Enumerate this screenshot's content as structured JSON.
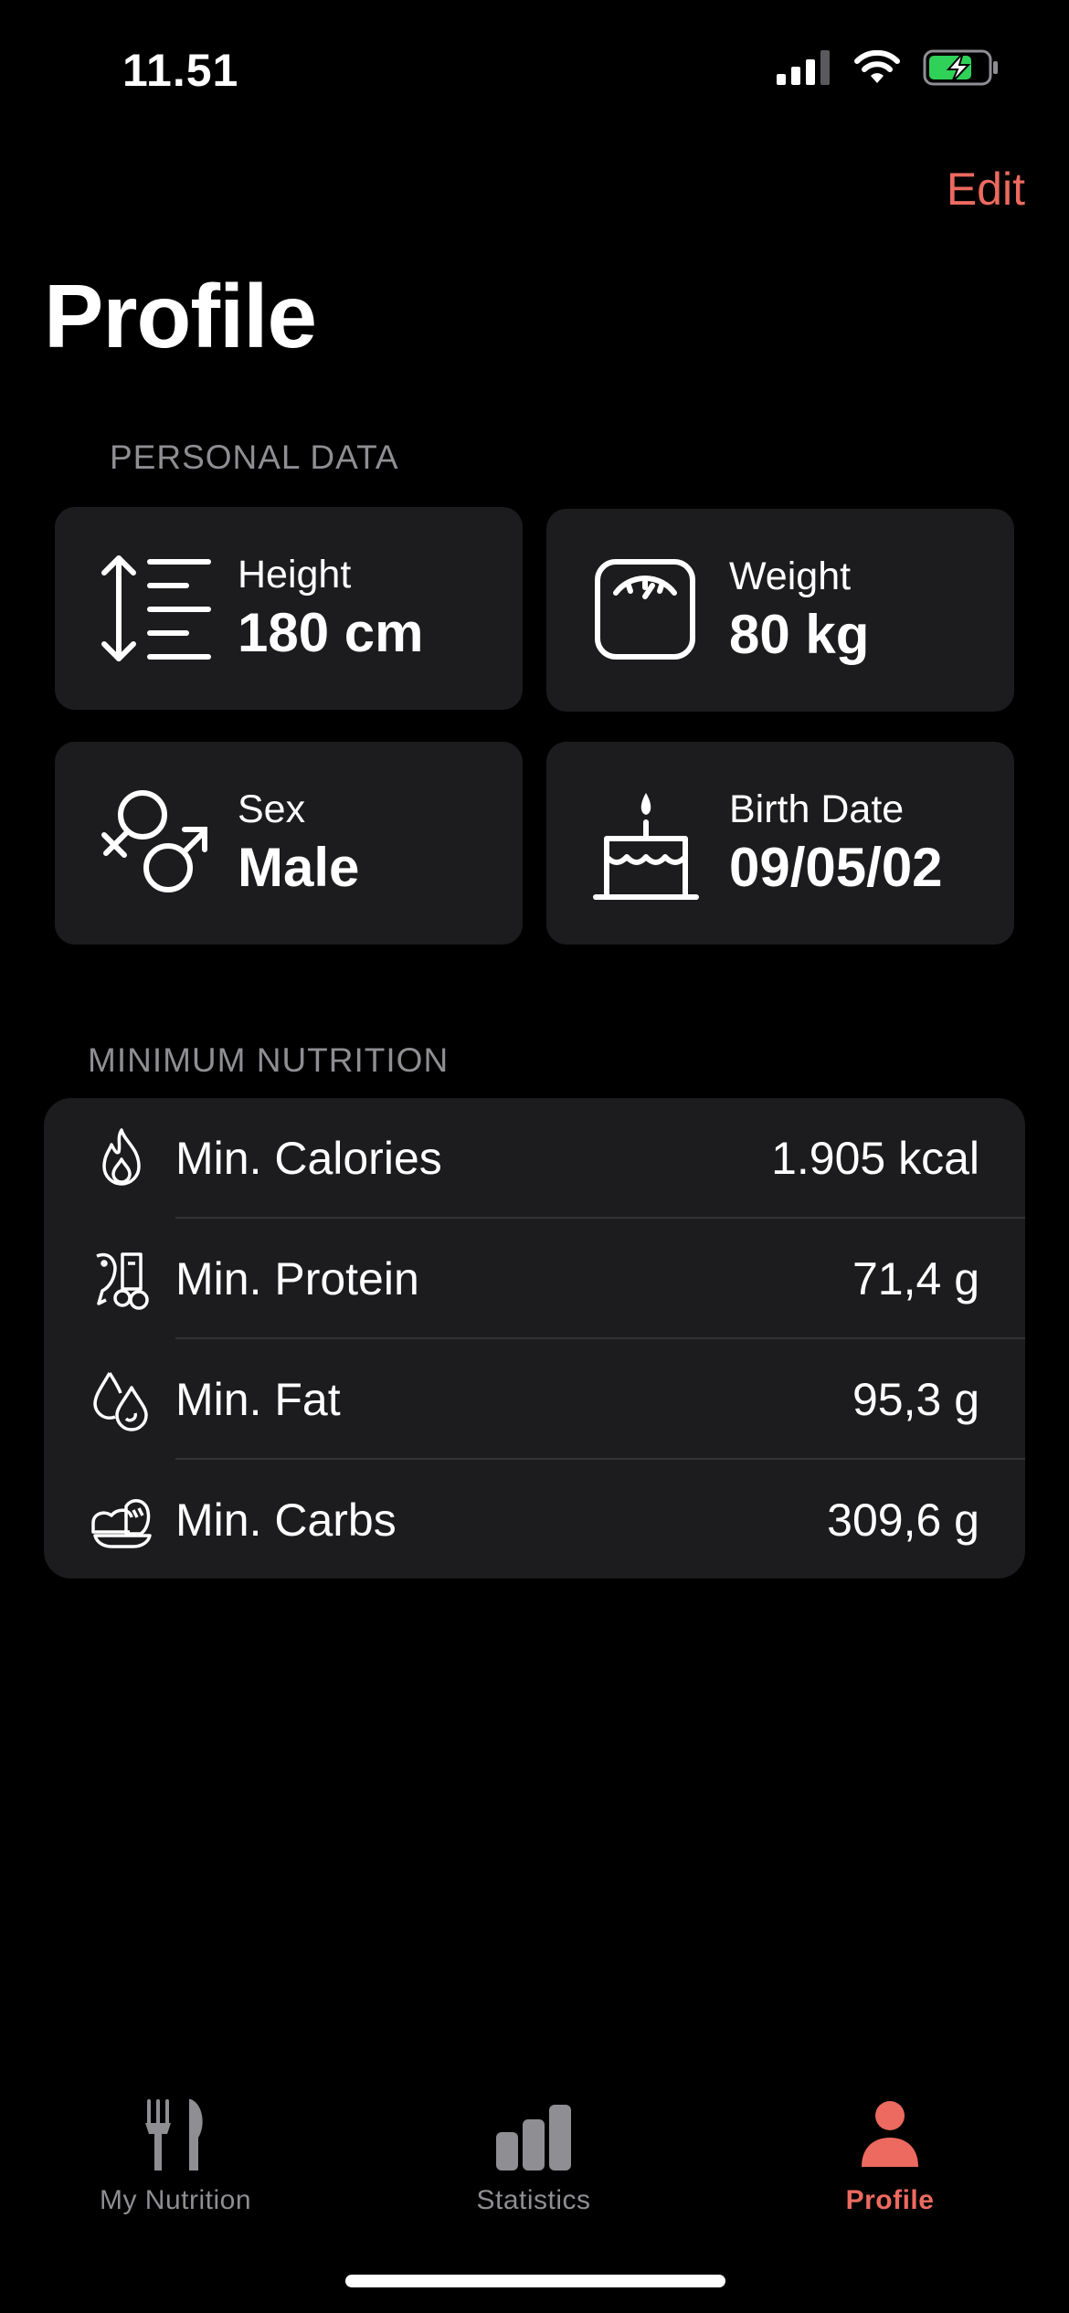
{
  "status_bar": {
    "time": "11.51"
  },
  "nav": {
    "edit_label": "Edit",
    "title": "Profile"
  },
  "personal": {
    "label": "PERSONAL DATA",
    "height": {
      "label": "Height",
      "value": "180 cm"
    },
    "weight": {
      "label": "Weight",
      "value": "80 kg"
    },
    "sex": {
      "label": "Sex",
      "value": "Male"
    },
    "birth": {
      "label": "Birth Date",
      "value": "09/05/02"
    }
  },
  "nutrition": {
    "label": "MINIMUM NUTRITION",
    "rows": [
      {
        "name": "Min. Calories",
        "value": "1.905 kcal",
        "icon": "fire-icon"
      },
      {
        "name": "Min. Protein",
        "value": "71,4 g",
        "icon": "protein-icon"
      },
      {
        "name": "Min. Fat",
        "value": "95,3 g",
        "icon": "fat-drops-icon"
      },
      {
        "name": "Min. Carbs",
        "value": "309,6 g",
        "icon": "carbs-bread-icon"
      }
    ]
  },
  "tabs": [
    {
      "label": "My Nutrition",
      "icon": "fork-knife-icon",
      "active": false
    },
    {
      "label": "Statistics",
      "icon": "bar-chart-icon",
      "active": false
    },
    {
      "label": "Profile",
      "icon": "person-icon",
      "active": true
    }
  ],
  "colors": {
    "accent": "#EC6A5F",
    "card": "#1C1C1E",
    "inactive": "#8E8E93",
    "battery": "#30D158"
  }
}
